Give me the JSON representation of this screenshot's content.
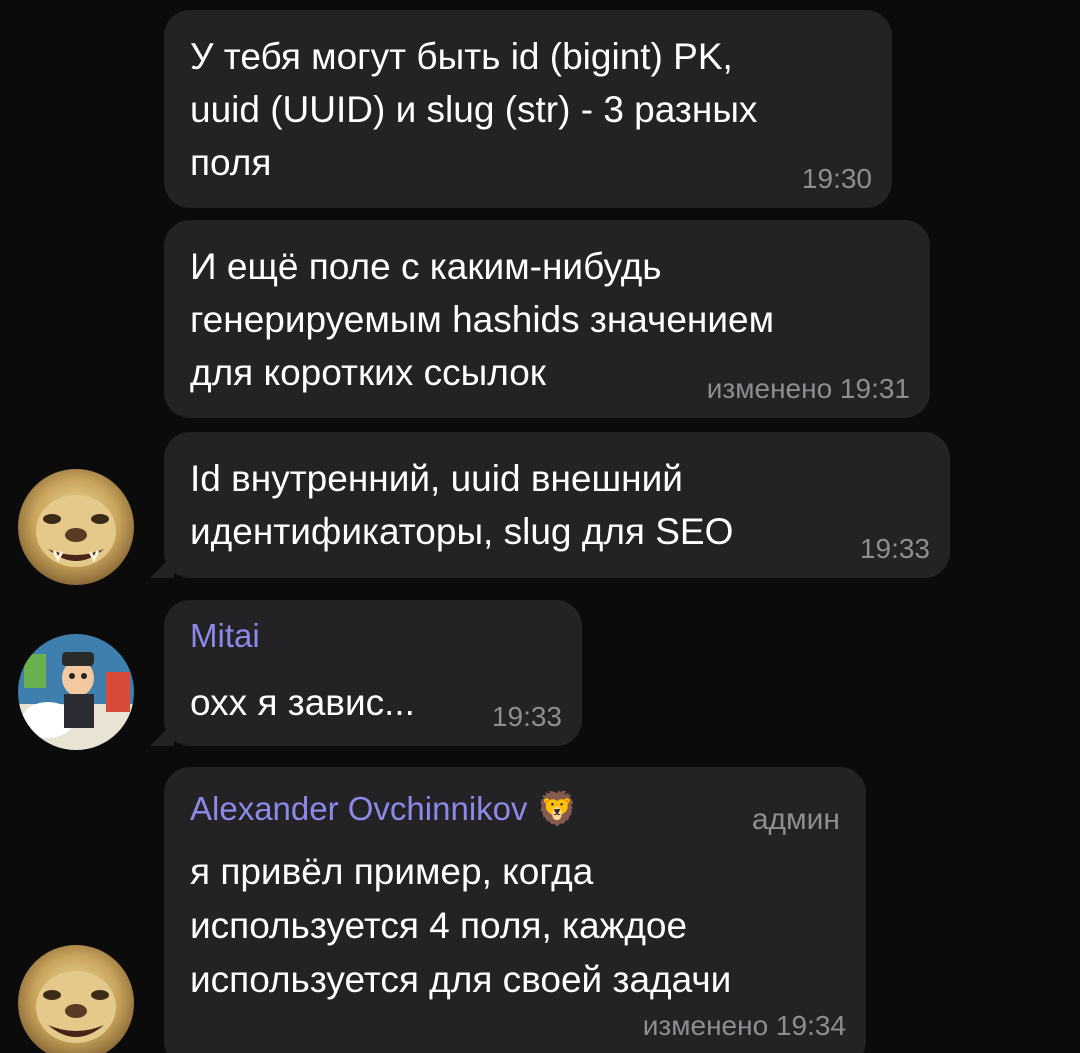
{
  "messages": [
    {
      "text": "У тебя могут быть id (bigint) PK,\nuuid (UUID) и slug (str) - 3 разных\nполя",
      "time": "19:30"
    },
    {
      "text": "И ещё поле с каким-нибудь\nгенерируемым hashids значением\nдля коротких ссылок",
      "time": "изменено 19:31"
    },
    {
      "text": "Id внутренний, uuid внешний\nидентификаторы, slug для SEO",
      "time": "19:33",
      "avatar_icon": "lion-avatar-icon"
    },
    {
      "sender": "Mitai",
      "text": "охх я завис...",
      "time": "19:33",
      "avatar_icon": "cartoon-avatar-icon"
    },
    {
      "sender": "Alexander Ovchinnikov",
      "sender_emoji": "🦁",
      "role": "админ",
      "text": "я привёл пример, когда\nиспользуется 4 поля, каждое\nиспользуется для своей задачи",
      "time": "изменено 19:34",
      "avatar_icon": "lion-avatar-icon"
    }
  ],
  "colors": {
    "background": "#0b0b0c",
    "bubble": "#232325",
    "sender_name": "#8e88e8",
    "meta_text": "#8d8d92"
  }
}
